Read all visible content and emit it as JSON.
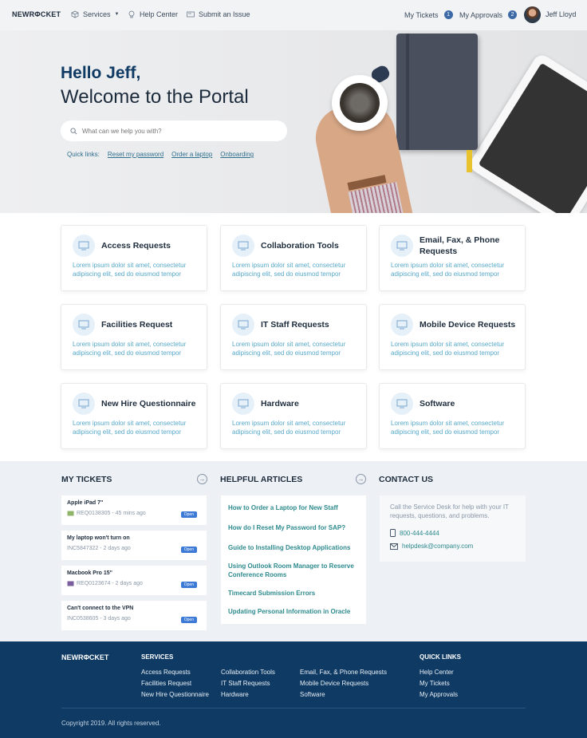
{
  "nav": {
    "logo": "NEWRΦCKET",
    "services": "Services",
    "help_center": "Help Center",
    "submit_issue": "Submit an Issue",
    "my_tickets": "My Tickets",
    "my_tickets_count": "1",
    "my_approvals": "My Approvals",
    "my_approvals_count": "2",
    "user_name": "Jeff Lloyd"
  },
  "hero": {
    "greeting": "Hello Jeff,",
    "welcome": "Welcome to the Portal",
    "search_placeholder": "What can we help you with?",
    "quick_links_label": "Quick links:",
    "quick_links": [
      "Reset my password",
      "Order a laptop",
      "Onboarding"
    ]
  },
  "cards": [
    {
      "title": "Access Requests",
      "desc": "Lorem ipsum dolor sit amet, consectetur adipiscing elit, sed do eiusmod tempor"
    },
    {
      "title": "Collaboration Tools",
      "desc": "Lorem ipsum dolor sit amet, consectetur adipiscing elit, sed do eiusmod tempor"
    },
    {
      "title": "Email, Fax, & Phone Requests",
      "desc": "Lorem ipsum dolor sit amet, consectetur adipiscing elit, sed do eiusmod tempor"
    },
    {
      "title": "Facilities Request",
      "desc": "Lorem ipsum dolor sit amet, consectetur adipiscing elit, sed do eiusmod tempor"
    },
    {
      "title": "IT Staff Requests",
      "desc": "Lorem ipsum dolor sit amet, consectetur adipiscing elit, sed do eiusmod tempor"
    },
    {
      "title": "Mobile Device Requests",
      "desc": "Lorem ipsum dolor sit amet, consectetur adipiscing elit, sed do eiusmod tempor"
    },
    {
      "title": "New Hire Questionnaire",
      "desc": "Lorem ipsum dolor sit amet, consectetur adipiscing elit, sed do eiusmod tempor"
    },
    {
      "title": "Hardware",
      "desc": "Lorem ipsum dolor sit amet, consectetur adipiscing elit, sed do eiusmod tempor"
    },
    {
      "title": "Software",
      "desc": "Lorem ipsum dolor sit amet, consectetur adipiscing elit, sed do eiusmod tempor"
    }
  ],
  "tickets": {
    "title": "MY TICKETS",
    "items": [
      {
        "title": "Apple iPad 7\"",
        "meta": "REQ0138305 - 45 mins ago",
        "status": "Open"
      },
      {
        "title": "My laptop won't turn on",
        "meta": "INC5847322 - 2 days ago",
        "status": "Open"
      },
      {
        "title": "Macbook Pro 15\"",
        "meta": "REQ0123674 - 2 days ago",
        "status": "Open"
      },
      {
        "title": "Can't connect to the VPN",
        "meta": "INC0538605 - 3 days ago",
        "status": "Open"
      }
    ]
  },
  "articles": {
    "title": "HELPFUL ARTICLES",
    "items": [
      "How to Order a Laptop for New Staff",
      "How do I Reset My Password for SAP?",
      "Guide to Installing Desktop Applications",
      "Using Outlook Room Manager to Reserve Conference Rooms",
      "Timecard Submission Errors",
      "Updating Personal Information in Oracle"
    ]
  },
  "contact": {
    "title": "CONTACT US",
    "desc": "Call the Service Desk for help with your IT requests, questions, and problems.",
    "phone": "800-444-4444",
    "email": "helpdesk@company.com"
  },
  "footer": {
    "logo": "NEWRΦCKET",
    "services_title": "SERVICES",
    "services_col1": [
      "Access Requests",
      "Facilities Request",
      "New Hire Questionnaire"
    ],
    "services_col2": [
      "Collaboration Tools",
      "IT Staff Requests",
      "Hardware"
    ],
    "services_col3": [
      "Email, Fax, & Phone Requests",
      "Mobile Device Requests",
      "Software"
    ],
    "quick_title": "QUICK LINKS",
    "quick_links": [
      "Help Center",
      "My Tickets",
      "My Approvals"
    ],
    "copyright": "Copyright 2019. All rights reserved."
  },
  "colors": {
    "brand": "#0e3a63",
    "accent_teal": "#2e8a8e",
    "badge_blue": "#3d6aa6"
  }
}
